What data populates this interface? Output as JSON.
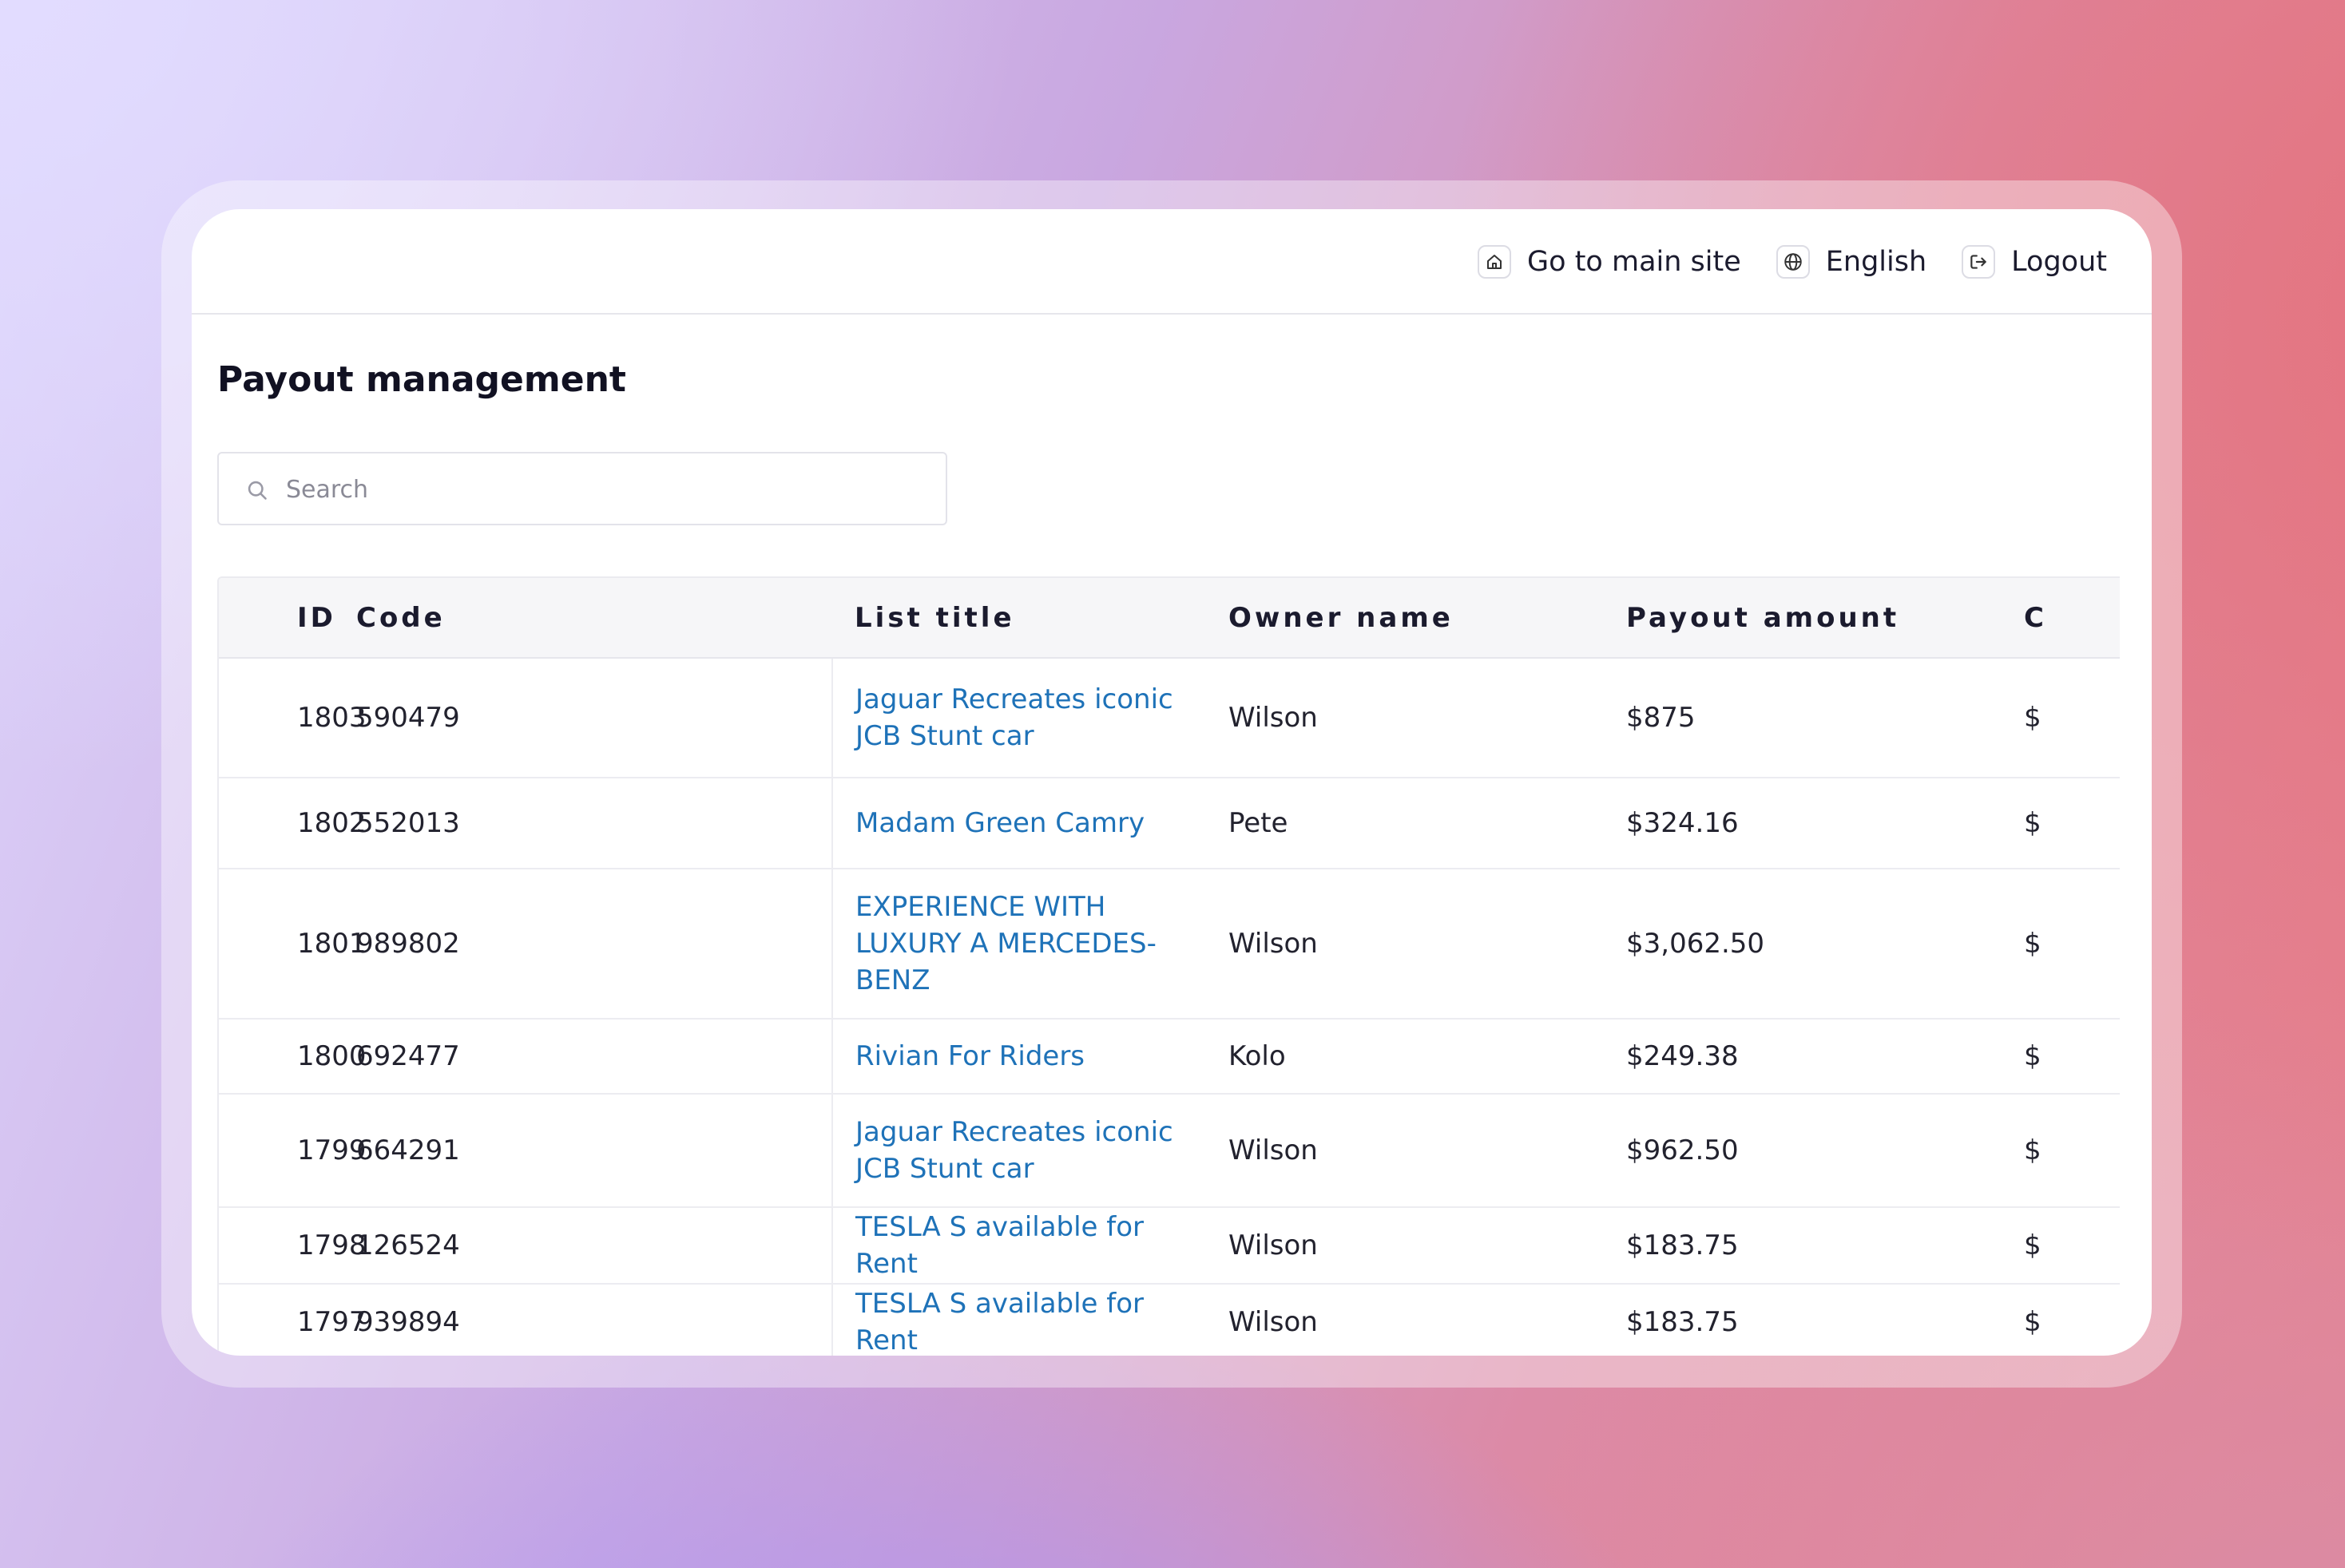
{
  "nav": {
    "main_site": "Go to main site",
    "language": "English",
    "logout": "Logout"
  },
  "page": {
    "title": "Payout management"
  },
  "search": {
    "placeholder": "Search"
  },
  "table": {
    "headers": [
      "ID",
      "Code",
      "List title",
      "Owner name",
      "Payout amount",
      "C"
    ],
    "rows": [
      {
        "id": "1803",
        "code": "590479",
        "title": "Jaguar Recreates iconic JCB Stunt car",
        "owner": "Wilson",
        "payout": "$875",
        "next": "$"
      },
      {
        "id": "1802",
        "code": "552013",
        "title": "Madam Green Camry",
        "owner": "Pete",
        "payout": "$324.16",
        "next": "$"
      },
      {
        "id": "1801",
        "code": "989802",
        "title": "EXPERIENCE WITH LUXURY A MERCEDES-BENZ",
        "owner": "Wilson",
        "payout": "$3,062.50",
        "next": "$"
      },
      {
        "id": "1800",
        "code": "692477",
        "title": "Rivian For Riders",
        "owner": "Kolo",
        "payout": "$249.38",
        "next": "$"
      },
      {
        "id": "1799",
        "code": "664291",
        "title": "Jaguar Recreates iconic JCB Stunt car",
        "owner": "Wilson",
        "payout": "$962.50",
        "next": "$"
      },
      {
        "id": "1798",
        "code": "126524",
        "title": "TESLA S available for Rent",
        "owner": "Wilson",
        "payout": "$183.75",
        "next": "$"
      },
      {
        "id": "1797",
        "code": "939894",
        "title": "TESLA S available for Rent",
        "owner": "Wilson",
        "payout": "$183.75",
        "next": "$"
      }
    ]
  }
}
